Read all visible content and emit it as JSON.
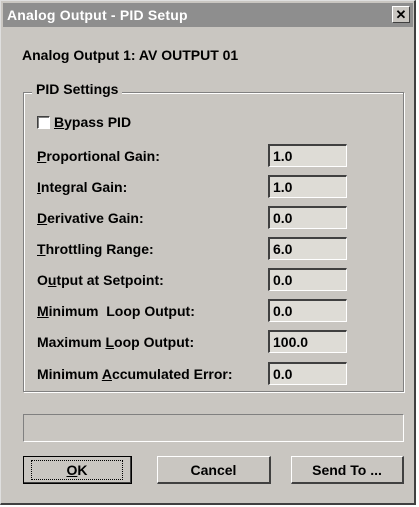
{
  "window": {
    "title": "Analog Output - PID Setup",
    "close_glyph": "✕"
  },
  "header": {
    "label": "Analog Output 1: AV OUTPUT 01"
  },
  "group": {
    "title": "PID Settings",
    "bypass": {
      "label_prefix": "B",
      "label_rest": "ypass PID",
      "checked": false
    }
  },
  "fields": [
    {
      "u": "P",
      "rest": "roportional Gain:",
      "value": "1.0"
    },
    {
      "u": "I",
      "rest": "ntegral Gain:",
      "value": "1.0"
    },
    {
      "u": "D",
      "rest": "erivative Gain:",
      "value": "0.0"
    },
    {
      "u": "T",
      "rest": "hrottling Range:",
      "value": "6.0"
    },
    {
      "pre": "O",
      "u": "u",
      "rest": "tput at Setpoint:",
      "value": "0.0"
    },
    {
      "u": "M",
      "rest": "inimum  Loop Output:",
      "value": "0.0"
    },
    {
      "pre": "Maximum ",
      "u": "L",
      "rest": "oop Output:",
      "value": "100.0"
    },
    {
      "pre": "Minimum ",
      "u": "A",
      "rest": "ccumulated Error:",
      "value": "0.0"
    }
  ],
  "buttons": {
    "ok": {
      "u": "O",
      "rest": "K"
    },
    "cancel": "Cancel",
    "send_to": "Send To ..."
  }
}
